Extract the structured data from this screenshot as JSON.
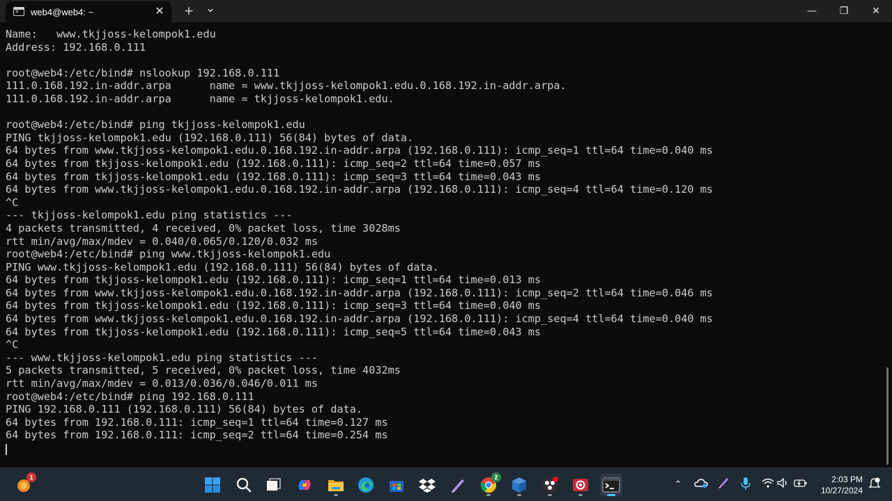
{
  "window": {
    "tab_title": "web4@web4: ~",
    "close_tab_glyph": "✕",
    "new_tab_glyph": "+",
    "dropdown_glyph": "⌄",
    "minimize_glyph": "—",
    "restore_glyph": "❐",
    "close_glyph": "✕"
  },
  "terminal": {
    "lines": [
      "Name:   www.tkjjoss-kelompok1.edu",
      "Address: 192.168.0.111",
      "",
      "root@web4:/etc/bind# nslookup 192.168.0.111",
      "111.0.168.192.in-addr.arpa      name = www.tkjjoss-kelompok1.edu.0.168.192.in-addr.arpa.",
      "111.0.168.192.in-addr.arpa      name = tkjjoss-kelompok1.edu.",
      "",
      "root@web4:/etc/bind# ping tkjjoss-kelompok1.edu",
      "PING tkjjoss-kelompok1.edu (192.168.0.111) 56(84) bytes of data.",
      "64 bytes from www.tkjjoss-kelompok1.edu.0.168.192.in-addr.arpa (192.168.0.111): icmp_seq=1 ttl=64 time=0.040 ms",
      "64 bytes from tkjjoss-kelompok1.edu (192.168.0.111): icmp_seq=2 ttl=64 time=0.057 ms",
      "64 bytes from tkjjoss-kelompok1.edu (192.168.0.111): icmp_seq=3 ttl=64 time=0.043 ms",
      "64 bytes from www.tkjjoss-kelompok1.edu.0.168.192.in-addr.arpa (192.168.0.111): icmp_seq=4 ttl=64 time=0.120 ms",
      "^C",
      "--- tkjjoss-kelompok1.edu ping statistics ---",
      "4 packets transmitted, 4 received, 0% packet loss, time 3028ms",
      "rtt min/avg/max/mdev = 0.040/0.065/0.120/0.032 ms",
      "root@web4:/etc/bind# ping www.tkjjoss-kelompok1.edu",
      "PING www.tkjjoss-kelompok1.edu (192.168.0.111) 56(84) bytes of data.",
      "64 bytes from tkjjoss-kelompok1.edu (192.168.0.111): icmp_seq=1 ttl=64 time=0.013 ms",
      "64 bytes from www.tkjjoss-kelompok1.edu.0.168.192.in-addr.arpa (192.168.0.111): icmp_seq=2 ttl=64 time=0.046 ms",
      "64 bytes from tkjjoss-kelompok1.edu (192.168.0.111): icmp_seq=3 ttl=64 time=0.040 ms",
      "64 bytes from www.tkjjoss-kelompok1.edu.0.168.192.in-addr.arpa (192.168.0.111): icmp_seq=4 ttl=64 time=0.040 ms",
      "64 bytes from tkjjoss-kelompok1.edu (192.168.0.111): icmp_seq=5 ttl=64 time=0.043 ms",
      "^C",
      "--- www.tkjjoss-kelompok1.edu ping statistics ---",
      "5 packets transmitted, 5 received, 0% packet loss, time 4032ms",
      "rtt min/avg/max/mdev = 0.013/0.036/0.046/0.011 ms",
      "root@web4:/etc/bind# ping 192.168.0.111",
      "PING 192.168.0.111 (192.168.0.111) 56(84) bytes of data.",
      "64 bytes from 192.168.0.111: icmp_seq=1 ttl=64 time=0.127 ms",
      "64 bytes from 192.168.0.111: icmp_seq=2 ttl=64 time=0.254 ms"
    ]
  },
  "taskbar": {
    "widgets_badge": "1",
    "chrome_badge": "2",
    "apps": [
      {
        "name": "widgets-icon"
      },
      {
        "name": "start-icon"
      },
      {
        "name": "search-icon"
      },
      {
        "name": "task-view-icon"
      },
      {
        "name": "copilot-icon"
      },
      {
        "name": "file-explorer-icon"
      },
      {
        "name": "edge-icon"
      },
      {
        "name": "store-icon"
      },
      {
        "name": "dropbox-icon"
      },
      {
        "name": "pen-icon"
      },
      {
        "name": "chrome-icon"
      },
      {
        "name": "virtualbox-icon"
      },
      {
        "name": "obs-icon"
      },
      {
        "name": "recorder-icon"
      },
      {
        "name": "terminal-icon"
      }
    ],
    "tray": {
      "chevron_glyph": "⌃",
      "time": "2:03 PM",
      "date": "10/27/2024"
    },
    "colors": {
      "accent": "#4cc2ff",
      "taskbar_bg": "#202a34"
    }
  }
}
